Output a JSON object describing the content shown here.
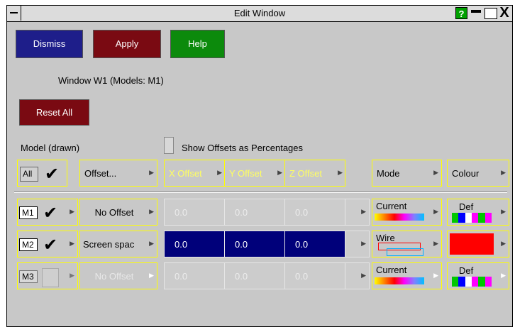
{
  "window": {
    "title": "Edit Window",
    "help_glyph": "?",
    "close_glyph": "X"
  },
  "buttons": {
    "dismiss": "Dismiss",
    "apply": "Apply",
    "help": "Help",
    "reset_all": "Reset All"
  },
  "info": {
    "window_label": "Window W1  (Models: M1)"
  },
  "labels": {
    "model_drawn": "Model (drawn)",
    "show_offsets": "Show Offsets as Percentages"
  },
  "header": {
    "all": "All",
    "offset": "Offset...",
    "x_offset": "X Offset",
    "y_offset": "Y Offset",
    "z_offset": "Z Offset",
    "mode": "Mode",
    "colour": "Colour"
  },
  "rows": [
    {
      "model": "M1",
      "checked": true,
      "offset": "No Offset",
      "x": "0.0",
      "y": "0.0",
      "z": "0.0",
      "mode": "Current",
      "colour": "Def"
    },
    {
      "model": "M2",
      "checked": true,
      "offset": "Screen spac",
      "x": "0.0",
      "y": "0.0",
      "z": "0.0",
      "mode": "Wire",
      "colour": ""
    },
    {
      "model": "M3",
      "checked": false,
      "offset": "No Offset",
      "x": "0.0",
      "y": "0.0",
      "z": "0.0",
      "mode": "Current",
      "colour": "Def"
    }
  ],
  "colors": {
    "dismiss": "#1e1e8a",
    "apply": "#7a0a12",
    "help": "#0c8a0c",
    "highlight": "#00007a",
    "outline": "#ffff00",
    "m2_colour": "#ff0000",
    "def_swatches": [
      "#00c800",
      "#0000ff",
      "#ffffff",
      "#ff00ff",
      "#00c800",
      "#ff00ff"
    ]
  },
  "icons": {
    "menu_arrow": "menu-arrow-icon",
    "checkmark": "checkmark-icon"
  }
}
